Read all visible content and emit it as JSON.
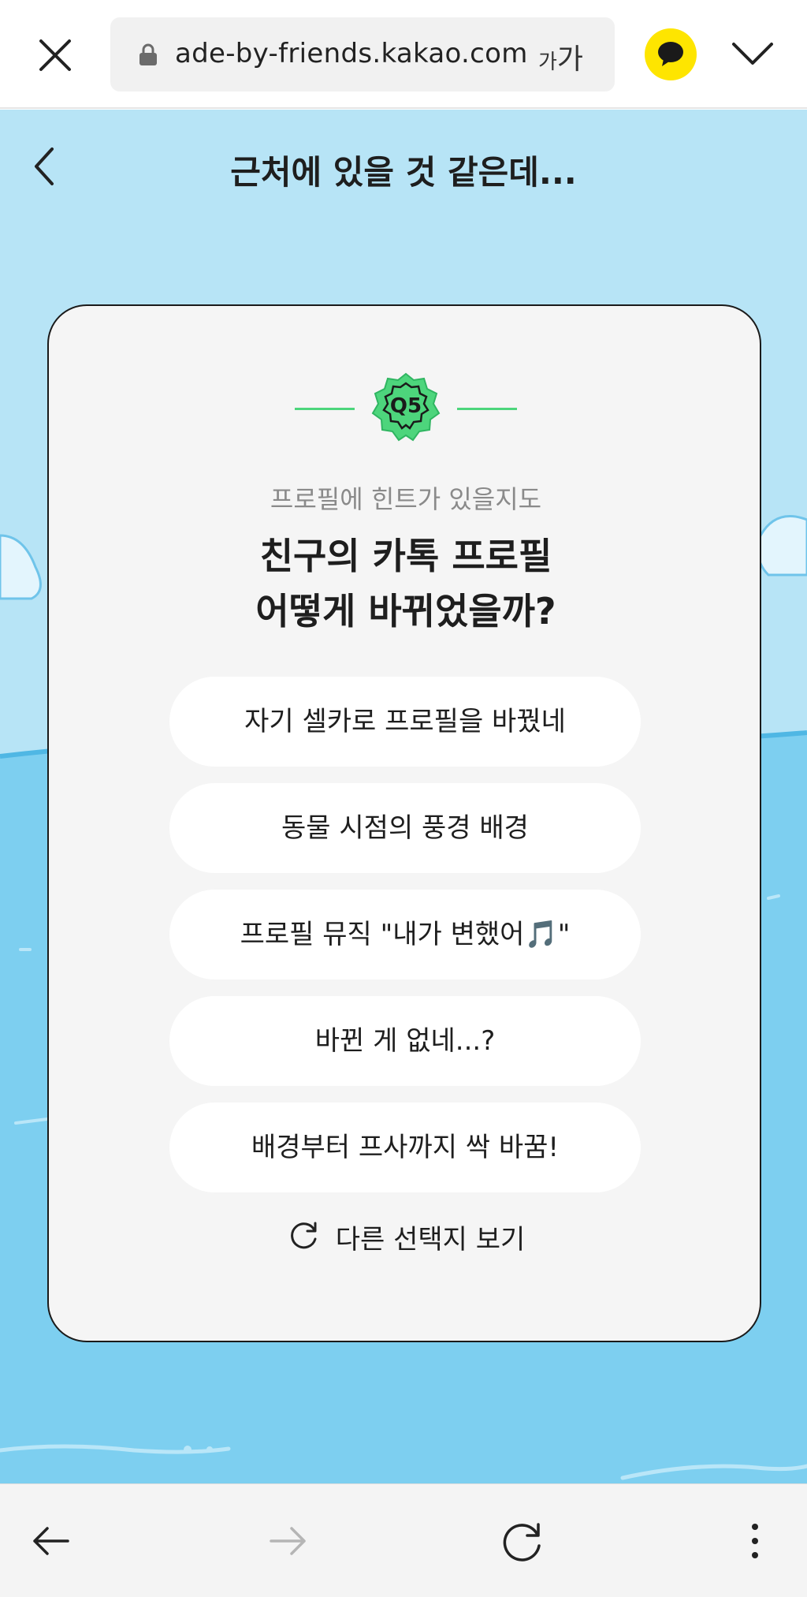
{
  "browser": {
    "url": "ade-by-friends.kakao.com",
    "text_size_small": "가",
    "text_size_large": "가"
  },
  "page": {
    "title": "근처에 있을 것 같은데..."
  },
  "quiz": {
    "badge": "Q5",
    "hint": "프로필에 힌트가 있을지도",
    "question_line1": "친구의 카톡 프로필",
    "question_line2": "어떻게 바뀌었을까?",
    "options": [
      "자기 셀카로 프로필을 바꿨네",
      "동물 시점의 풍경 배경",
      "프로필 뮤직 \"내가 변했어🎵\"",
      "바뀐 게 없네...?",
      "배경부터 프사까지 싹 바꿈!"
    ],
    "refresh_label": "다른 선택지 보기"
  },
  "colors": {
    "sky": "#b7e4f6",
    "water": "#7dcff0",
    "badge_green": "#4dd57c",
    "kakao_yellow": "#fee500"
  }
}
